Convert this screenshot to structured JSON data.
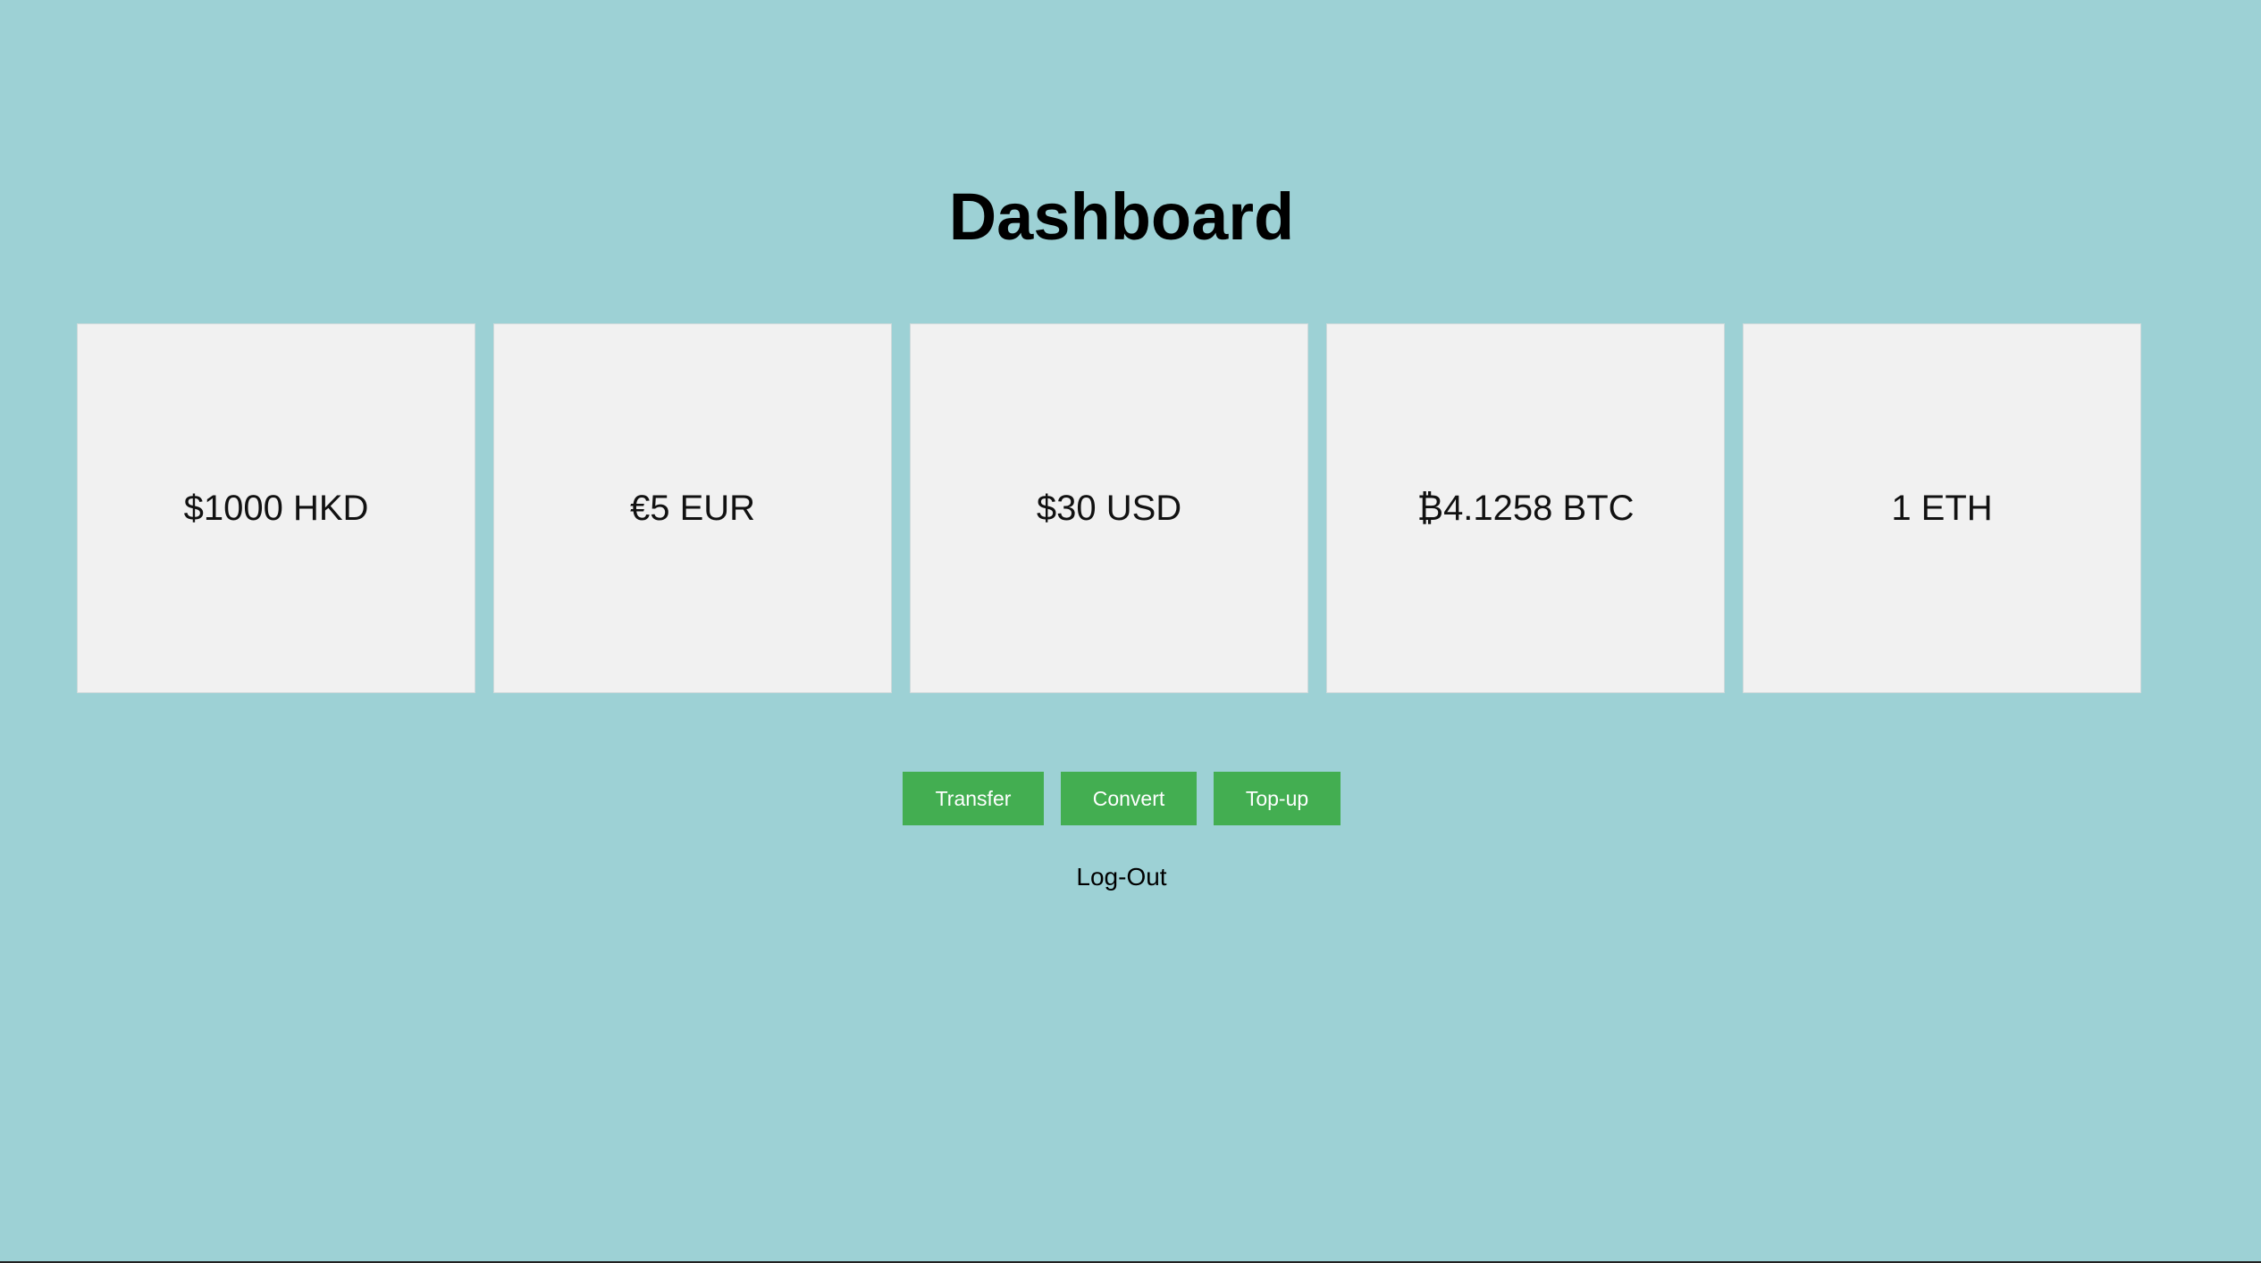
{
  "page": {
    "title": "Dashboard"
  },
  "balances": [
    {
      "label": "$1000 HKD"
    },
    {
      "label": "€5 EUR"
    },
    {
      "label": "$30 USD"
    },
    {
      "label": "₿4.1258 BTC"
    },
    {
      "label": "1 ETH"
    }
  ],
  "actions": {
    "transfer_label": "Transfer",
    "convert_label": "Convert",
    "topup_label": "Top-up"
  },
  "logout": {
    "label": "Log-Out"
  },
  "colors": {
    "background": "#9dd1d5",
    "card": "#f1f1f1",
    "button": "#43ae51"
  }
}
